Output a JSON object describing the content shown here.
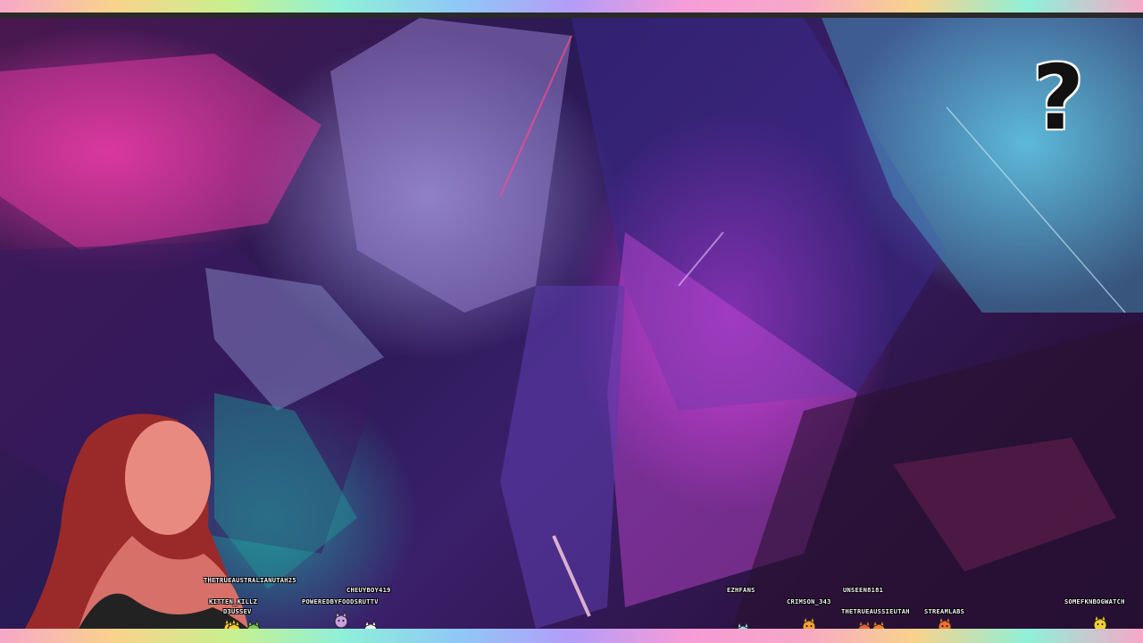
{
  "overlay": {
    "help_icon": "?",
    "accent_colors": [
      "#f7a8c8",
      "#f9d28c",
      "#8ff0d8",
      "#8fc9f7",
      "#b49cf7"
    ]
  },
  "viewers": [
    {
      "name": "THETRUEAUSTRALIANUTAH25",
      "sprite": "pikachu-sprite"
    },
    {
      "name": "KITTEN_KILLZ",
      "sprite": "bulbasaur-sprite"
    },
    {
      "name": "D3USSEV",
      "sprite": "pikachu-hat-sprite"
    },
    {
      "name": "CHEUYBOY419",
      "sprite": "espeon-sprite"
    },
    {
      "name": "POWEREDBYFOODSRUTTV",
      "sprite": "white-ghost-sprite"
    },
    {
      "name": "EZHFANS",
      "sprite": "water-sprite"
    },
    {
      "name": "CRIMSON_343",
      "sprite": "torchic-sprite"
    },
    {
      "name": "UNSEEN8181",
      "sprite": "fox-sprite"
    },
    {
      "name": "THETRUEAUSSIEUTAH",
      "sprite": "fire-fox-sprite"
    },
    {
      "name": "STREAMLABS",
      "sprite": "charmander-sprite"
    },
    {
      "name": "SOMEFKNBOGWATCH",
      "sprite": "witch-pikachu-sprite"
    }
  ]
}
